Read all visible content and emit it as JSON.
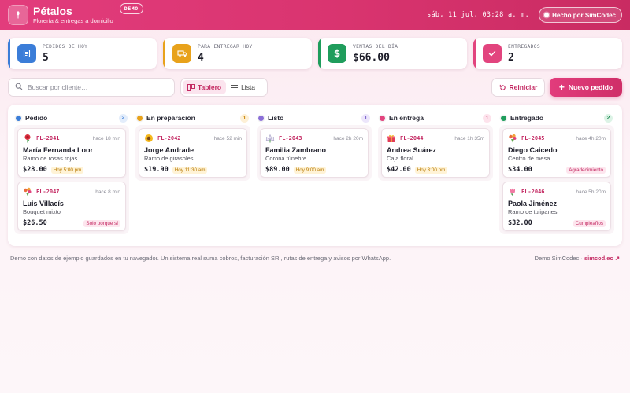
{
  "app": {
    "name": "Pétalos",
    "subtitle": "Florería & entregas a domicilio",
    "badge": "DEMO",
    "datetime": "sáb, 11 jul, 03:28 a. m.",
    "made_by": "Hecho por SimCodec"
  },
  "stats": [
    {
      "label": "PEDIDOS DE HOY",
      "value": "5",
      "color": "#3b7dd8",
      "icon": "document-icon"
    },
    {
      "label": "PARA ENTREGAR HOY",
      "value": "4",
      "color": "#e8a21b",
      "icon": "truck-icon"
    },
    {
      "label": "VENTAS DEL DÍA",
      "value": "$66.00",
      "color": "#1f9d5c",
      "icon": "dollar-icon"
    },
    {
      "label": "ENTREGADOS",
      "value": "2",
      "color": "#e2447e",
      "icon": "check-icon"
    }
  ],
  "toolbar": {
    "search_placeholder": "Buscar por cliente…",
    "view_board": "Tablero",
    "view_list": "Lista",
    "reset": "Reiniciar",
    "new_order": "Nuevo pedido"
  },
  "columns": [
    {
      "name": "Pedido",
      "count": "2",
      "dot": "#3b7dd8",
      "count_bg": "#e3edfb",
      "count_fg": "#3b7dd8",
      "cards": [
        {
          "flower": "rose-icon",
          "code": "FL-2041",
          "time": "hace 18 min",
          "client": "María Fernanda Loor",
          "product": "Ramo de rosas rojas",
          "price": "$28.00",
          "tag": "Hoy 5:00 pm",
          "tag_type": "time"
        },
        {
          "flower": "bouquet-icon",
          "code": "FL-2047",
          "time": "hace 8 min",
          "client": "Luis Villacís",
          "product": "Bouquet mixto",
          "price": "$26.50",
          "tag": "Solo porque sí",
          "tag_type": "occasion"
        }
      ]
    },
    {
      "name": "En preparación",
      "count": "1",
      "dot": "#e8a21b",
      "count_bg": "#fdf0d6",
      "count_fg": "#c98300",
      "cards": [
        {
          "flower": "sunflower-icon",
          "code": "FL-2042",
          "time": "hace 52 min",
          "client": "Jorge Andrade",
          "product": "Ramo de girasoles",
          "price": "$19.90",
          "tag": "Hoy 11:30 am",
          "tag_type": "time"
        }
      ]
    },
    {
      "name": "Listo",
      "count": "1",
      "dot": "#8b6fd8",
      "count_bg": "#ece6fb",
      "count_fg": "#7257c9",
      "cards": [
        {
          "flower": "lily-icon",
          "code": "FL-2043",
          "time": "hace 2h 20m",
          "client": "Familia Zambrano",
          "product": "Corona fúnebre",
          "price": "$89.00",
          "tag": "Hoy 9:00 am",
          "tag_type": "time"
        }
      ]
    },
    {
      "name": "En entrega",
      "count": "1",
      "dot": "#e2447e",
      "count_bg": "#fde3ec",
      "count_fg": "#c42a63",
      "cards": [
        {
          "flower": "gift-icon",
          "code": "FL-2044",
          "time": "hace 1h 35m",
          "client": "Andrea Suárez",
          "product": "Caja floral",
          "price": "$42.00",
          "tag": "Hoy 3:00 pm",
          "tag_type": "time"
        }
      ]
    },
    {
      "name": "Entregado",
      "count": "2",
      "dot": "#1f9d5c",
      "count_bg": "#dcf3e6",
      "count_fg": "#1f8a52",
      "cards": [
        {
          "flower": "bouquet-icon",
          "code": "FL-2045",
          "time": "hace 4h 20m",
          "client": "Diego Caicedo",
          "product": "Centro de mesa",
          "price": "$34.00",
          "tag": "Agradecimiento",
          "tag_type": "occasion"
        },
        {
          "flower": "tulip-icon",
          "code": "FL-2046",
          "time": "hace 5h 20m",
          "client": "Paola Jiménez",
          "product": "Ramo de tulipanes",
          "price": "$32.00",
          "tag": "Cumpleaños",
          "tag_type": "occasion"
        }
      ]
    }
  ],
  "footer": {
    "note": "Demo con datos de ejemplo guardados en tu navegador. Un sistema real suma cobros, facturación SRI, rutas de entrega y avisos por WhatsApp.",
    "credit_prefix": "Demo SimCodec ·",
    "credit_link": "simcod.ec ↗"
  }
}
